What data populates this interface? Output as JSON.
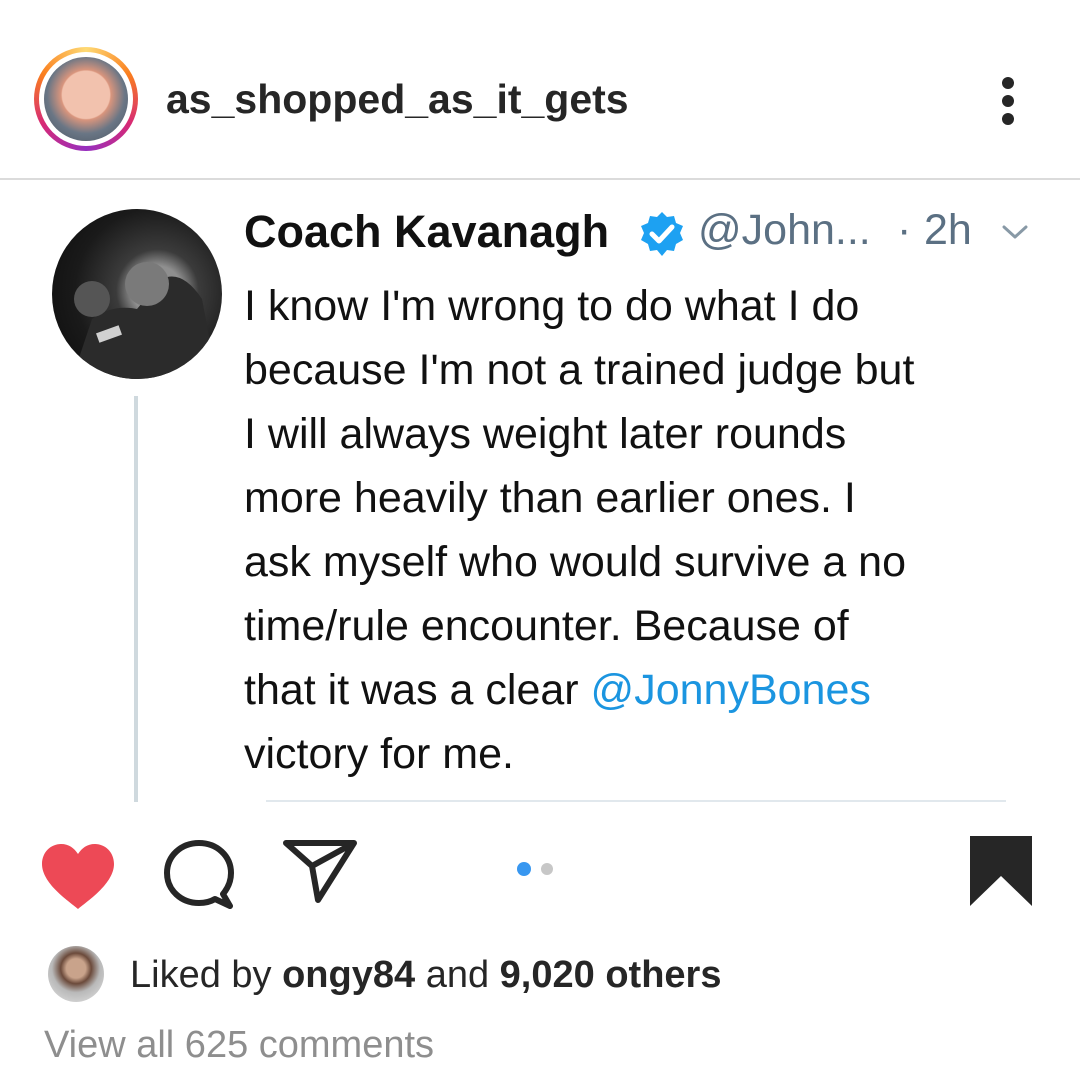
{
  "post": {
    "username": "as_shopped_as_it_gets",
    "more_icon": "more-vertical-icon"
  },
  "tweet": {
    "author": "Coach Kavanagh",
    "handle": "@John...",
    "separator": "·",
    "time": "2h",
    "text_lines": [
      "I know I'm wrong to do what I do",
      "because I'm not a trained judge but",
      "I will always weight later rounds",
      "more heavily than earlier ones. I",
      "ask myself who would survive a no",
      "time/rule encounter. Because of"
    ],
    "line7_prefix": "that it was a clear ",
    "mention": "@JonnyBones",
    "line8": "victory for me.",
    "mention_color": "#1b95e0"
  },
  "actions": {
    "like_icon": "heart-filled-icon",
    "comment_icon": "comment-icon",
    "share_icon": "paper-plane-icon",
    "save_icon": "bookmark-filled-icon",
    "like_color": "#ed4956",
    "carousel_active_color": "#3897f0"
  },
  "likes": {
    "prefix": "Liked by ",
    "user": "ongy84",
    "middle": " and ",
    "others": "9,020 others"
  },
  "comments": {
    "view_all": "View all 625 comments"
  }
}
